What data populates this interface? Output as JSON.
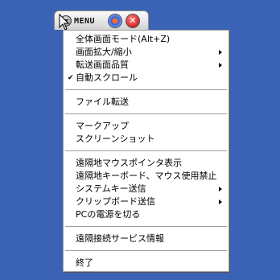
{
  "toolbar": {
    "menu_label": "MENU",
    "close_glyph": "✕",
    "icons": [
      "menu-dropdown-icon",
      "view-toggle-icon",
      "close-icon"
    ]
  },
  "menu": {
    "groups": [
      [
        {
          "label": "全体画面モード(Alt+Z)",
          "submenu": false,
          "checked": false
        },
        {
          "label": "画面拡大/縮小",
          "submenu": true,
          "checked": false
        },
        {
          "label": "転送画面品質",
          "submenu": true,
          "checked": false
        },
        {
          "label": "自動スクロール",
          "submenu": false,
          "checked": true
        }
      ],
      [
        {
          "label": "ファイル転送",
          "submenu": false,
          "checked": false
        }
      ],
      [
        {
          "label": "マークアップ",
          "submenu": false,
          "checked": false
        },
        {
          "label": "スクリーンショット",
          "submenu": false,
          "checked": false
        }
      ],
      [
        {
          "label": "遠隔地マウスポインタ表示",
          "submenu": false,
          "checked": false
        },
        {
          "label": "遠隔地キーボード、マウス使用禁止",
          "submenu": false,
          "checked": false
        },
        {
          "label": "システムキー送信",
          "submenu": true,
          "checked": false
        },
        {
          "label": "クリップボード送信",
          "submenu": true,
          "checked": false
        },
        {
          "label": "PCの電源を切る",
          "submenu": false,
          "checked": false
        }
      ],
      [
        {
          "label": "遠隔接続サービス情報",
          "submenu": false,
          "checked": false
        }
      ],
      [
        {
          "label": "終了",
          "submenu": false,
          "checked": false
        }
      ]
    ],
    "check_glyph": "✔"
  },
  "colors": {
    "desktop": "#3a63b5",
    "menu_bg": "#ffffff",
    "separator": "#a0a0a0"
  }
}
